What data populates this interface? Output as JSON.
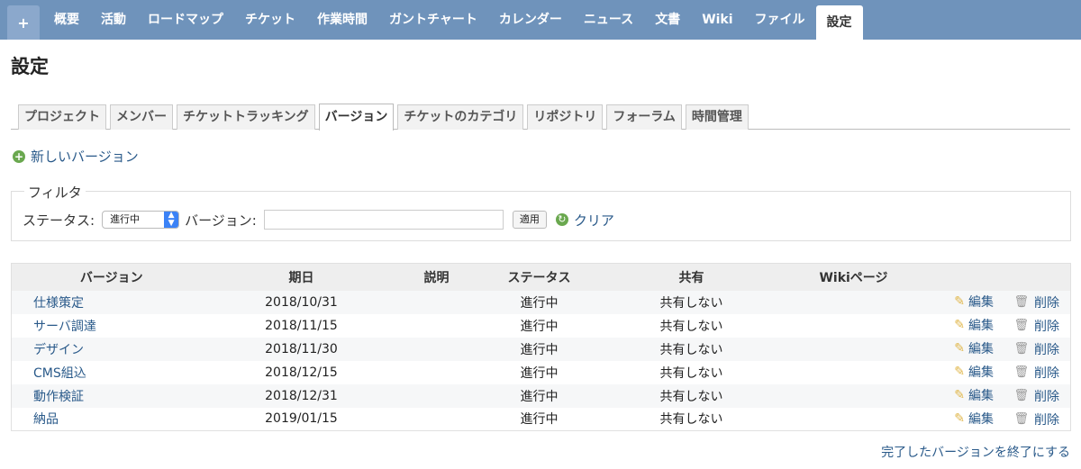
{
  "nav": {
    "plus": "+",
    "items": [
      "概要",
      "活動",
      "ロードマップ",
      "チケット",
      "作業時間",
      "ガントチャート",
      "カレンダー",
      "ニュース",
      "文書",
      "Wiki",
      "ファイル",
      "設定"
    ],
    "active_index": 11
  },
  "page_title": "設定",
  "tabs": [
    "プロジェクト",
    "メンバー",
    "チケットトラッキング",
    "バージョン",
    "チケットのカテゴリ",
    "リポジトリ",
    "フォーラム",
    "時間管理"
  ],
  "active_tab": 3,
  "new_version_label": "新しいバージョン",
  "filter": {
    "legend": "フィルタ",
    "status_label": "ステータス:",
    "status_value": "進行中",
    "version_label": "バージョン:",
    "version_value": "",
    "apply_label": "適用",
    "clear_label": "クリア"
  },
  "table": {
    "headers": [
      "バージョン",
      "期日",
      "説明",
      "ステータス",
      "共有",
      "Wikiページ",
      ""
    ],
    "rows": [
      {
        "name": "仕様策定",
        "date": "2018/10/31",
        "desc": "",
        "status": "進行中",
        "sharing": "共有しない",
        "wiki": ""
      },
      {
        "name": "サーバ調達",
        "date": "2018/11/15",
        "desc": "",
        "status": "進行中",
        "sharing": "共有しない",
        "wiki": ""
      },
      {
        "name": "デザイン",
        "date": "2018/11/30",
        "desc": "",
        "status": "進行中",
        "sharing": "共有しない",
        "wiki": ""
      },
      {
        "name": "CMS組込",
        "date": "2018/12/15",
        "desc": "",
        "status": "進行中",
        "sharing": "共有しない",
        "wiki": ""
      },
      {
        "name": "動作検証",
        "date": "2018/12/31",
        "desc": "",
        "status": "進行中",
        "sharing": "共有しない",
        "wiki": ""
      },
      {
        "name": "納品",
        "date": "2019/01/15",
        "desc": "",
        "status": "進行中",
        "sharing": "共有しない",
        "wiki": ""
      }
    ],
    "edit_label": "編集",
    "delete_label": "削除"
  },
  "close_completed_label": "完了したバージョンを終了にする",
  "colors": {
    "nav_bg": "#6f93bb",
    "link": "#2a5a8a",
    "accent_green": "#6aa84f"
  }
}
